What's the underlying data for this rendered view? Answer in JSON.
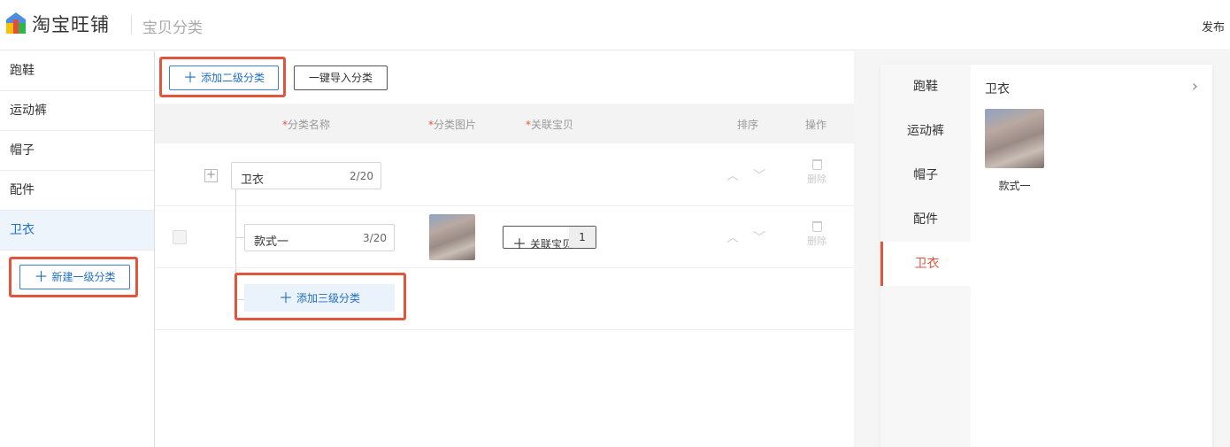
{
  "header": {
    "app_name": "淘宝旺铺",
    "page_title": "宝贝分类",
    "publish_label": "发布"
  },
  "sidebar": {
    "items": [
      {
        "label": "跑鞋",
        "active": false
      },
      {
        "label": "运动裤",
        "active": false
      },
      {
        "label": "帽子",
        "active": false
      },
      {
        "label": "配件",
        "active": false
      },
      {
        "label": "卫衣",
        "active": true
      }
    ],
    "new_category_label": "新建一级分类"
  },
  "toolbar": {
    "add_second_level_label": "添加二级分类",
    "import_label": "一键导入分类"
  },
  "table": {
    "required_mark": "*",
    "col_name": "分类名称",
    "col_image": "分类图片",
    "col_related": "关联宝贝",
    "col_sort": "排序",
    "col_action": "操作",
    "rows": [
      {
        "name": "卫衣",
        "count": "2/20",
        "delete_label": "删除"
      },
      {
        "name": "款式一",
        "count": "3/20",
        "related_label": "关联宝贝",
        "related_count": "1",
        "delete_label": "删除"
      }
    ],
    "add_third_level_label": "添加三级分类"
  },
  "preview": {
    "nav_items": [
      {
        "label": "跑鞋",
        "active": false
      },
      {
        "label": "运动裤",
        "active": false
      },
      {
        "label": "帽子",
        "active": false
      },
      {
        "label": "配件",
        "active": false
      },
      {
        "label": "卫衣",
        "active": true
      }
    ],
    "title": "卫衣",
    "sub_item_label": "款式一"
  },
  "colors": {
    "accent_blue": "#1f6fc5",
    "highlight_red": "#e0553b",
    "active_bg": "#eef4fc"
  },
  "icons": [
    "taobao-wangpu-logo-icon",
    "plus-icon",
    "chevron-up-icon",
    "chevron-down-icon",
    "trash-icon",
    "chevron-right-icon"
  ]
}
